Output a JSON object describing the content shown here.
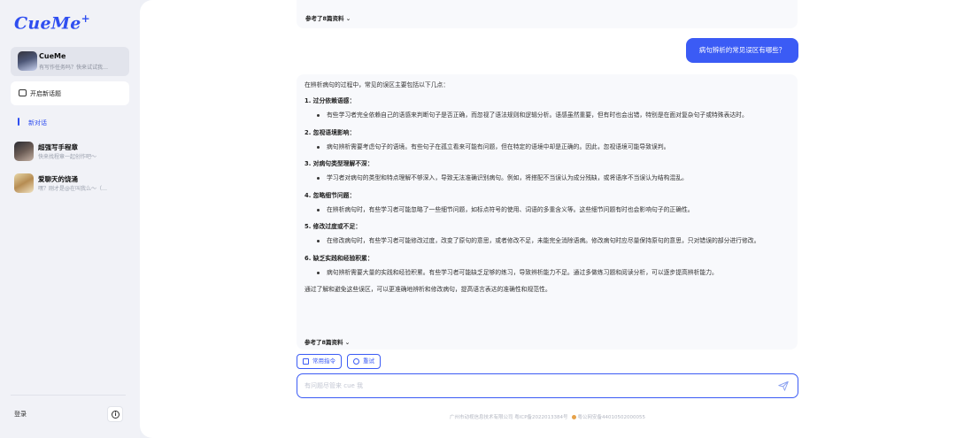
{
  "sidebar": {
    "logo": "CueMe",
    "logo_plus": "+",
    "assistant": {
      "name": "CueMe",
      "desc": "有写作任务吗？快来试试我…"
    },
    "new_topic_label": "开启新话题",
    "current_chat_label": "新对话",
    "history": [
      {
        "title": "超强写手程章",
        "desc": "快来找程章一起创作吧～"
      },
      {
        "title": "爱聊天的饶涌",
        "desc": "嘿？刚才是@在叫我么～（…"
      }
    ],
    "login_label": "登录",
    "info_icon_text": "i"
  },
  "chat": {
    "ref_label": "参考了8篇资料",
    "ref_chevron": "⌄",
    "user_message": "病句辨析的常见误区有哪些？",
    "answer": {
      "intro": "在辨析病句的过程中，常见的误区主要包括以下几点：",
      "sections": [
        {
          "title": "1. 过分依赖语感：",
          "body": "有些学习者完全依赖自己的语感来判断句子是否正确，而忽视了语法规则和逻辑分析。语感虽然重要，但有时也会出错，特别是在面对复杂句子或特殊表达时。"
        },
        {
          "title": "2. 忽视语境影响：",
          "body": "病句辨析需要考虑句子的语境。有些句子在孤立看来可能有问题，但在特定的语境中却是正确的。因此，忽视语境可能导致误判。"
        },
        {
          "title": "3. 对病句类型理解不深：",
          "body": "学习者对病句的类型和特点理解不够深入，导致无法准确识别病句。例如，将搭配不当误认为成分残缺，或将语序不当误认为结构混乱。"
        },
        {
          "title": "4. 忽略细节问题：",
          "body": "在辨析病句时，有些学习者可能忽略了一些细节问题，如标点符号的使用、词语的多重含义等。这些细节问题有时也会影响句子的正确性。"
        },
        {
          "title": "5. 修改过度或不足：",
          "body": "在修改病句时，有些学习者可能修改过度，改变了原句的意思，或者修改不足，未能完全消除语病。修改病句时应尽量保持原句的意思，只对错误的部分进行修改。"
        },
        {
          "title": "6. 缺乏实践和经验积累：",
          "body": "病句辨析需要大量的实践和经验积累。有些学习者可能缺乏足够的练习，导致辨析能力不足。通过多做练习题和阅读分析，可以逐步提高辨析能力。"
        }
      ],
      "outro": "通过了解和避免这些误区，可以更准确地辨析和修改病句，提高语言表达的准确性和规范性。"
    }
  },
  "actions": {
    "common_commands": "常用指令",
    "retry": "重试"
  },
  "input": {
    "placeholder": "有问题尽管来 cue 我",
    "value": ""
  },
  "footer": {
    "icp": "广州市动视信息技术有限公司 粤ICP备2022013384号",
    "police": "粤公网安备44010502000055"
  },
  "colors": {
    "accent": "#3b5bf5",
    "sidebar_bg": "#f1f2f7",
    "answer_bg": "#f8f9fc"
  }
}
